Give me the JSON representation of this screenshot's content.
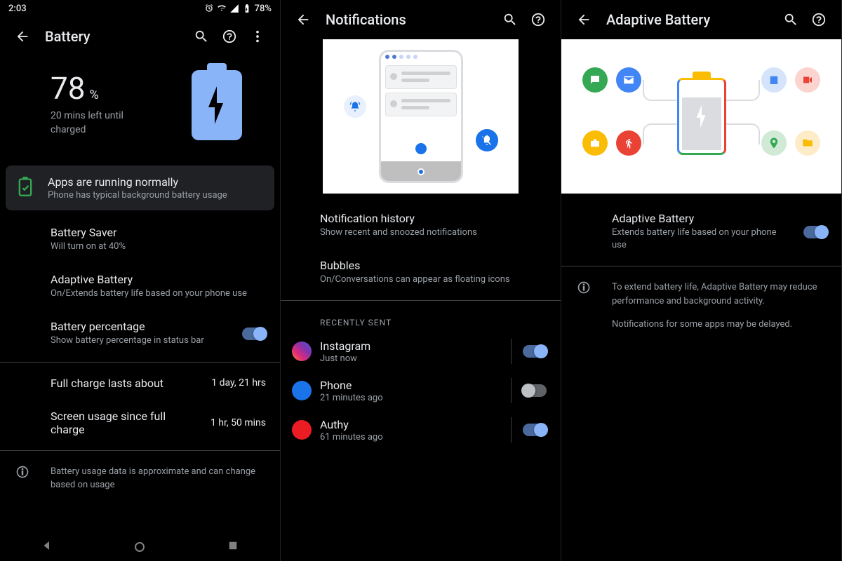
{
  "statusbar": {
    "time": "2:03",
    "battery_pct": "78%"
  },
  "screen1": {
    "title": "Battery",
    "hero": {
      "pct": "78",
      "pct_unit": "%",
      "sub": "20 mins left until charged"
    },
    "card": {
      "title": "Apps are running normally",
      "sub": "Phone has typical background battery usage"
    },
    "rows": {
      "saver": {
        "title": "Battery Saver",
        "sub": "Will turn on at 40%"
      },
      "adaptive": {
        "title": "Adaptive Battery",
        "sub": "On/Extends battery life based on your phone use"
      },
      "percentage": {
        "title": "Battery percentage",
        "sub": "Show battery percentage in status bar"
      },
      "full_charge": {
        "title": "Full charge lasts about",
        "value": "1 day, 21 hrs"
      },
      "screen_usage": {
        "title": "Screen usage since full charge",
        "value": "1 hr, 50 mins"
      }
    },
    "footer_info": "Battery usage data is approximate and can change based on usage"
  },
  "screen2": {
    "title": "Notifications",
    "rows": {
      "history": {
        "title": "Notification history",
        "sub": "Show recent and snoozed notifications"
      },
      "bubbles": {
        "title": "Bubbles",
        "sub": "On/Conversations can appear as floating icons"
      }
    },
    "section_header": "RECENTLY SENT",
    "apps": [
      {
        "name": "Instagram",
        "sub": "Just now",
        "on": true,
        "color": "linear-gradient(45deg,#f58529,#dd2a7b,#8134af,#515bd4)"
      },
      {
        "name": "Phone",
        "sub": "21 minutes ago",
        "on": false,
        "color": "#1a73e8"
      },
      {
        "name": "Authy",
        "sub": "61 minutes ago",
        "on": true,
        "color": "#ec1c24"
      }
    ]
  },
  "screen3": {
    "title": "Adaptive Battery",
    "toggle_row": {
      "title": "Adaptive Battery",
      "sub": "Extends battery life based on your phone use"
    },
    "info1": "To extend battery life, Adaptive Battery may reduce performance and background activity.",
    "info2": "Notifications for some apps may be delayed."
  }
}
